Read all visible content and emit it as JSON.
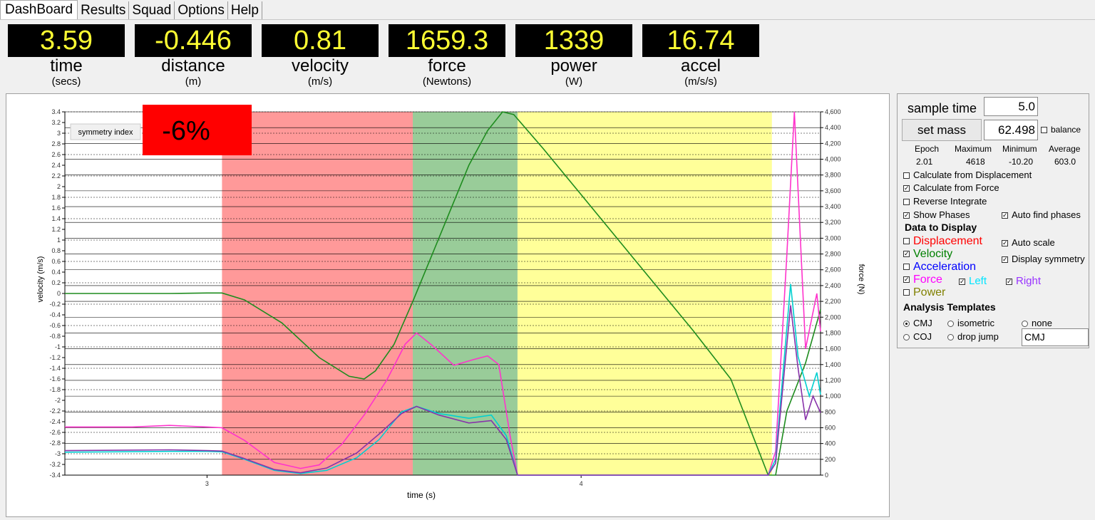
{
  "tabs": [
    "DashBoard",
    "Results",
    "Squad",
    "Options",
    "Help"
  ],
  "metrics": [
    {
      "value": "3.59",
      "name": "time",
      "unit": "(secs)"
    },
    {
      "value": "-0.446",
      "name": "distance",
      "unit": "(m)"
    },
    {
      "value": "0.81",
      "name": "velocity",
      "unit": "(m/s)"
    },
    {
      "value": "1659.3",
      "name": "force",
      "unit": "(Newtons)"
    },
    {
      "value": "1339",
      "name": "power",
      "unit": "(W)"
    },
    {
      "value": "16.74",
      "name": "accel",
      "unit": "(m/s/s)"
    }
  ],
  "symmetry": {
    "label": "symmetry index",
    "value": "-6%",
    "color": "#ff0000"
  },
  "panel": {
    "sample_time_label": "sample time",
    "sample_time_value": "5.0",
    "set_mass_label": "set mass",
    "mass_value": "62.498",
    "balance_label": "balance",
    "stats_headers": [
      "Epoch",
      "Maximum",
      "Minimum",
      "Average"
    ],
    "stats_values": [
      "2.01",
      "4618",
      "-10.20",
      "603.0"
    ],
    "calc_displacement": "Calculate from Displacement",
    "calc_force": "Calculate from Force",
    "reverse_integrate": "Reverse Integrate",
    "show_phases": "Show Phases",
    "auto_find_phases": "Auto find phases",
    "data_to_display": "Data to Display",
    "displacement": "Displacement",
    "velocity": "Velocity",
    "acceleration": "Acceleration",
    "force": "Force",
    "left": "Left",
    "right": "Right",
    "power": "Power",
    "auto_scale": "Auto scale",
    "display_symmetry": "Display symmetry",
    "analysis_templates": "Analysis Templates",
    "tpl_cmj": "CMJ",
    "tpl_isometric": "isometric",
    "tpl_none": "none",
    "tpl_coj": "COJ",
    "tpl_dropjump": "drop jump",
    "template_value": "CMJ",
    "colors": {
      "displacement": "#ff0000",
      "velocity": "#008000",
      "acceleration": "#0000ff",
      "force": "#ff00ff",
      "left": "#00e5ff",
      "right": "#9933ff",
      "power": "#808000"
    }
  },
  "chart_data": {
    "type": "line",
    "xlabel": "time (s)",
    "ylabel": "velocity (m/s)",
    "y2label": "force (N)",
    "xlim": [
      2.62,
      4.64
    ],
    "xticks": [
      3,
      4
    ],
    "ylim": [
      -3.4,
      3.4
    ],
    "yticks": [
      "3.4",
      "3.2",
      "3",
      "2.8",
      "2.6",
      "2.4",
      "2.2",
      "2",
      "1.8",
      "1.6",
      "1.4",
      "1.2",
      "1",
      "0.8",
      "0.6",
      "0.4",
      "0.2",
      "0",
      "-0.2",
      "-0.4",
      "-0.6",
      "-0.8",
      "-1",
      "-1.2",
      "-1.4",
      "-1.6",
      "-1.8",
      "-2",
      "-2.2",
      "-2.4",
      "-2.6",
      "-2.8",
      "-3",
      "-3.2",
      "-3.4"
    ],
    "y2lim": [
      0,
      4600
    ],
    "y2ticks": [
      "4,600",
      "4,400",
      "4,200",
      "4,000",
      "3,800",
      "3,600",
      "3,400",
      "3,200",
      "3,000",
      "2,800",
      "2,600",
      "2,400",
      "2,200",
      "2,000",
      "1,800",
      "1,600",
      "1,400",
      "1,200",
      "1,000",
      "800",
      "600",
      "400",
      "200",
      "0"
    ],
    "phases": [
      {
        "from": 3.04,
        "to": 3.55,
        "color": "#ff9999"
      },
      {
        "from": 3.55,
        "to": 3.83,
        "color": "#99cc99"
      },
      {
        "from": 3.83,
        "to": 4.51,
        "color": "#ffff99"
      }
    ],
    "series": [
      {
        "name": "Velocity",
        "axis": "left",
        "color": "#1e8c1e",
        "points": [
          [
            2.62,
            0
          ],
          [
            2.9,
            0
          ],
          [
            3.0,
            0.01
          ],
          [
            3.04,
            0.01
          ],
          [
            3.1,
            -0.12
          ],
          [
            3.2,
            -0.55
          ],
          [
            3.3,
            -1.2
          ],
          [
            3.38,
            -1.55
          ],
          [
            3.42,
            -1.6
          ],
          [
            3.45,
            -1.45
          ],
          [
            3.5,
            -0.95
          ],
          [
            3.55,
            -0.15
          ],
          [
            3.6,
            0.7
          ],
          [
            3.65,
            1.55
          ],
          [
            3.7,
            2.4
          ],
          [
            3.75,
            3.05
          ],
          [
            3.79,
            3.4
          ],
          [
            3.82,
            3.35
          ],
          [
            3.9,
            2.7
          ],
          [
            4.0,
            1.85
          ],
          [
            4.1,
            1.0
          ],
          [
            4.2,
            0.15
          ],
          [
            4.3,
            -0.7
          ],
          [
            4.4,
            -1.6
          ],
          [
            4.5,
            -3.4
          ],
          [
            4.52,
            -3.4
          ],
          [
            4.55,
            -2.2
          ],
          [
            4.6,
            -1.3
          ],
          [
            4.64,
            -0.3
          ]
        ]
      },
      {
        "name": "Force",
        "axis": "right",
        "color": "#ff33cc",
        "points": [
          [
            2.62,
            610
          ],
          [
            2.8,
            610
          ],
          [
            2.9,
            630
          ],
          [
            3.0,
            610
          ],
          [
            3.04,
            600
          ],
          [
            3.1,
            440
          ],
          [
            3.18,
            160
          ],
          [
            3.25,
            85
          ],
          [
            3.3,
            130
          ],
          [
            3.36,
            390
          ],
          [
            3.42,
            760
          ],
          [
            3.48,
            1200
          ],
          [
            3.53,
            1660
          ],
          [
            3.56,
            1800
          ],
          [
            3.6,
            1650
          ],
          [
            3.66,
            1390
          ],
          [
            3.71,
            1460
          ],
          [
            3.75,
            1510
          ],
          [
            3.78,
            1400
          ],
          [
            3.81,
            500
          ],
          [
            3.83,
            0
          ],
          [
            4.5,
            0
          ],
          [
            4.52,
            300
          ],
          [
            4.55,
            2800
          ],
          [
            4.57,
            4600
          ],
          [
            4.6,
            1600
          ],
          [
            4.63,
            2300
          ],
          [
            4.64,
            1820
          ]
        ]
      },
      {
        "name": "Left",
        "axis": "right",
        "color": "#00d0d0",
        "points": [
          [
            2.62,
            290
          ],
          [
            2.9,
            300
          ],
          [
            3.0,
            300
          ],
          [
            3.04,
            295
          ],
          [
            3.1,
            200
          ],
          [
            3.18,
            60
          ],
          [
            3.25,
            20
          ],
          [
            3.32,
            60
          ],
          [
            3.4,
            220
          ],
          [
            3.46,
            450
          ],
          [
            3.52,
            800
          ],
          [
            3.56,
            870
          ],
          [
            3.62,
            780
          ],
          [
            3.7,
            720
          ],
          [
            3.76,
            760
          ],
          [
            3.8,
            500
          ],
          [
            3.83,
            0
          ],
          [
            4.5,
            0
          ],
          [
            4.52,
            200
          ],
          [
            4.56,
            2420
          ],
          [
            4.58,
            1500
          ],
          [
            4.61,
            1000
          ],
          [
            4.63,
            1300
          ],
          [
            4.64,
            1020
          ]
        ]
      },
      {
        "name": "Right",
        "axis": "right",
        "color": "#8833aa",
        "points": [
          [
            2.62,
            310
          ],
          [
            2.9,
            320
          ],
          [
            3.0,
            310
          ],
          [
            3.04,
            305
          ],
          [
            3.1,
            210
          ],
          [
            3.18,
            70
          ],
          [
            3.25,
            30
          ],
          [
            3.32,
            90
          ],
          [
            3.4,
            280
          ],
          [
            3.46,
            520
          ],
          [
            3.52,
            780
          ],
          [
            3.56,
            870
          ],
          [
            3.62,
            760
          ],
          [
            3.7,
            660
          ],
          [
            3.76,
            690
          ],
          [
            3.8,
            450
          ],
          [
            3.83,
            0
          ],
          [
            4.5,
            0
          ],
          [
            4.52,
            150
          ],
          [
            4.56,
            2150
          ],
          [
            4.58,
            1350
          ],
          [
            4.6,
            700
          ],
          [
            4.62,
            1000
          ],
          [
            4.64,
            790
          ]
        ]
      }
    ]
  }
}
